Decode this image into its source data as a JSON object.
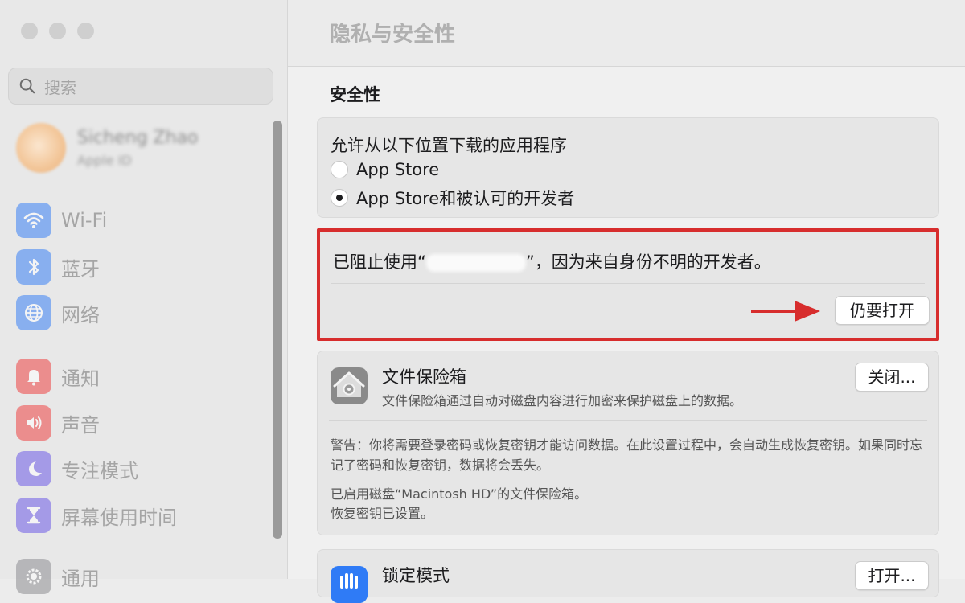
{
  "window": {
    "title": "隐私与安全性"
  },
  "sidebar": {
    "search_placeholder": "搜索",
    "user": {
      "name": "Sicheng Zhao",
      "subtitle": "Apple ID"
    },
    "items": [
      {
        "label": "Wi-Fi",
        "icon": "wifi-icon"
      },
      {
        "label": "蓝牙",
        "icon": "bluetooth-icon"
      },
      {
        "label": "网络",
        "icon": "globe-icon"
      },
      {
        "label": "通知",
        "icon": "bell-icon"
      },
      {
        "label": "声音",
        "icon": "speaker-icon"
      },
      {
        "label": "专注模式",
        "icon": "moon-icon"
      },
      {
        "label": "屏幕使用时间",
        "icon": "hourglass-icon"
      },
      {
        "label": "通用",
        "icon": "gear-icon"
      }
    ]
  },
  "security": {
    "heading": "安全性",
    "allow_label": "允许从以下位置下载的应用程序",
    "options": [
      {
        "label": "App Store",
        "selected": false
      },
      {
        "label": "App Store和被认可的开发者",
        "selected": true
      }
    ],
    "blocked": {
      "prefix": "已阻止使用“",
      "suffix": "”，因为来自身份不明的开发者。",
      "button": "仍要打开"
    }
  },
  "filevault": {
    "title": "文件保险箱",
    "description": "文件保险箱通过自动对磁盘内容进行加密来保护磁盘上的数据。",
    "button": "关闭...",
    "warning": "警告：你将需要登录密码或恢复密钥才能访问数据。在此设置过程中，会自动生成恢复密钥。如果同时忘记了密码和恢复密钥，数据将会丢失。",
    "status_line1": "已启用磁盘“Macintosh HD”的文件保险箱。",
    "status_line2": "恢复密钥已设置。"
  },
  "lockdown": {
    "title": "锁定模式",
    "button": "打开..."
  },
  "colors": {
    "highlight": "#d72d2d",
    "accent": "#2f7bf6"
  }
}
